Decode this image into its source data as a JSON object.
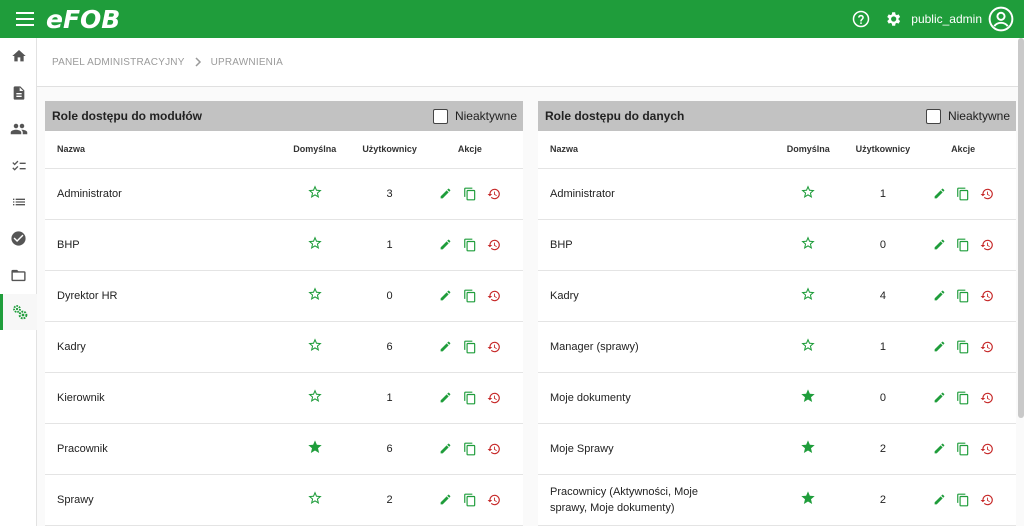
{
  "app": {
    "logo_text": "eFOB",
    "user_name": "public_admin"
  },
  "colors": {
    "brand": "#1f9d3b",
    "danger": "#c62828",
    "panel_header": "#c2c2c2"
  },
  "sidebar": {
    "items": [
      {
        "icon": "home-icon"
      },
      {
        "icon": "document-icon"
      },
      {
        "icon": "people-icon"
      },
      {
        "icon": "checklist-icon"
      },
      {
        "icon": "list-icon"
      },
      {
        "icon": "check-circle-icon"
      },
      {
        "icon": "folder-icon"
      },
      {
        "icon": "settings-cogs-icon",
        "active": true
      }
    ]
  },
  "breadcrumb": [
    "PANEL ADMINISTRACYJNY",
    "UPRAWNIENIA"
  ],
  "columns": {
    "name": "Nazwa",
    "default": "Domyślna",
    "users": "Użytkownicy",
    "actions": "Akcje"
  },
  "modules_panel": {
    "title": "Role dostępu do modułów",
    "inactive_label": "Nieaktywne",
    "rows": [
      {
        "name": "Administrator",
        "default": false,
        "users": "3"
      },
      {
        "name": "BHP",
        "default": false,
        "users": "1"
      },
      {
        "name": "Dyrektor HR",
        "default": false,
        "users": "0"
      },
      {
        "name": "Kadry",
        "default": false,
        "users": "6"
      },
      {
        "name": "Kierownik",
        "default": false,
        "users": "1"
      },
      {
        "name": "Pracownik",
        "default": true,
        "users": "6"
      },
      {
        "name": "Sprawy",
        "default": false,
        "users": "2"
      }
    ]
  },
  "data_panel": {
    "title": "Role dostępu do danych",
    "inactive_label": "Nieaktywne",
    "rows": [
      {
        "name": "Administrator",
        "default": false,
        "users": "1"
      },
      {
        "name": "BHP",
        "default": false,
        "users": "0"
      },
      {
        "name": "Kadry",
        "default": false,
        "users": "4"
      },
      {
        "name": "Manager (sprawy)",
        "default": false,
        "users": "1"
      },
      {
        "name": "Moje dokumenty",
        "default": true,
        "users": "0"
      },
      {
        "name": "Moje Sprawy",
        "default": true,
        "users": "2"
      },
      {
        "name": "Pracownicy (Aktywności, Moje sprawy, Moje dokumenty)",
        "default": true,
        "users": "2"
      }
    ]
  }
}
